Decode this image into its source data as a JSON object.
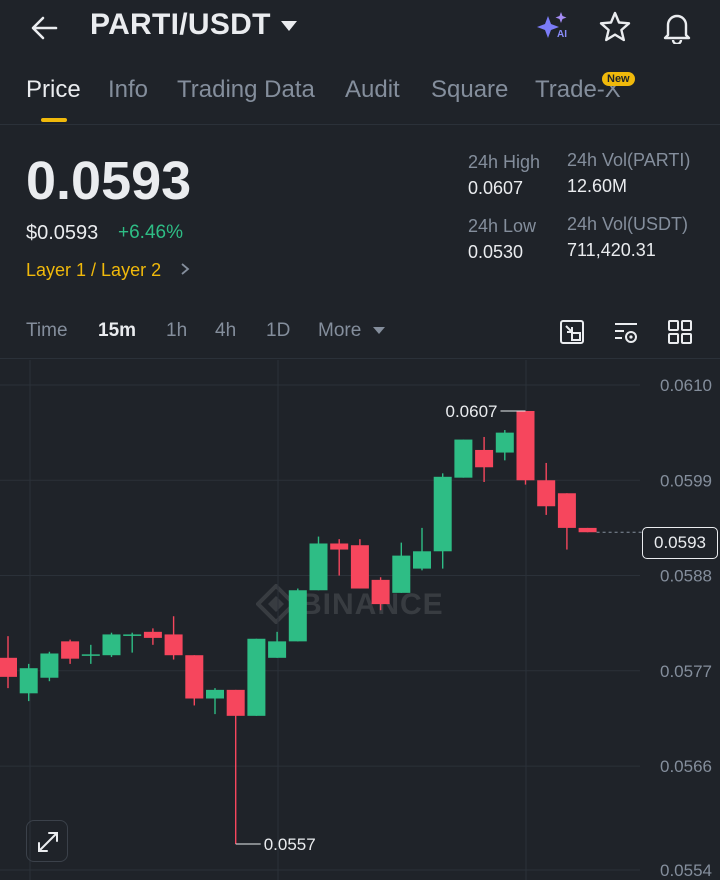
{
  "header": {
    "pair": "PARTI/USDT",
    "icons": [
      "back-arrow-icon",
      "caret-down-icon",
      "ai-sparkle-icon",
      "star-icon",
      "bell-icon"
    ]
  },
  "tabs": [
    {
      "label": "Price",
      "active": true
    },
    {
      "label": "Info"
    },
    {
      "label": "Trading Data"
    },
    {
      "label": "Audit"
    },
    {
      "label": "Square"
    },
    {
      "label": "Trade-X",
      "badge": "New"
    }
  ],
  "price": {
    "last": "0.0593",
    "usd": "$0.0593",
    "change": "+6.46%",
    "category": "Layer 1 / Layer 2"
  },
  "stats": {
    "high_label": "24h High",
    "high_value": "0.0607",
    "low_label": "24h Low",
    "low_value": "0.0530",
    "vol_base_label": "24h Vol(PARTI)",
    "vol_base_value": "12.60M",
    "vol_quote_label": "24h Vol(USDT)",
    "vol_quote_value": "711,420.31"
  },
  "intervals": [
    "Time",
    "15m",
    "1h",
    "4h",
    "1D",
    "More"
  ],
  "active_interval": "15m",
  "toolbar_icons": [
    "indicator-settings-icon",
    "chart-settings-icon",
    "grid-layout-icon"
  ],
  "colors": {
    "up": "#2ebd85",
    "down": "#f6465d",
    "accent": "#f0b90b",
    "background": "#1f2329"
  },
  "chart_data": {
    "type": "candlestick",
    "y_ticks": [
      "0.0610",
      "0.0599",
      "0.0588",
      "0.0577",
      "0.0566",
      "0.0554"
    ],
    "ylim": [
      0.0554,
      0.061
    ],
    "current_price": "0.0593",
    "high_marker": "0.0607",
    "low_marker": "0.0557",
    "watermark": "BINANCE",
    "candles": [
      {
        "o": 0.05785,
        "h": 0.0581,
        "l": 0.0575,
        "c": 0.05763
      },
      {
        "o": 0.05744,
        "h": 0.05778,
        "l": 0.05735,
        "c": 0.05773
      },
      {
        "o": 0.05762,
        "h": 0.05792,
        "l": 0.05758,
        "c": 0.0579
      },
      {
        "o": 0.05804,
        "h": 0.05806,
        "l": 0.05778,
        "c": 0.05784
      },
      {
        "o": 0.05788,
        "h": 0.058,
        "l": 0.05778,
        "c": 0.05789
      },
      {
        "o": 0.05788,
        "h": 0.05814,
        "l": 0.05786,
        "c": 0.05812
      },
      {
        "o": 0.05812,
        "h": 0.05814,
        "l": 0.05791,
        "c": 0.05812
      },
      {
        "o": 0.05815,
        "h": 0.05819,
        "l": 0.058,
        "c": 0.05808
      },
      {
        "o": 0.05812,
        "h": 0.05833,
        "l": 0.05783,
        "c": 0.05788
      },
      {
        "o": 0.05788,
        "h": 0.05788,
        "l": 0.0573,
        "c": 0.05738
      },
      {
        "o": 0.05738,
        "h": 0.0575,
        "l": 0.0572,
        "c": 0.05748
      },
      {
        "o": 0.05748,
        "h": 0.05748,
        "l": 0.0557,
        "c": 0.05718
      },
      {
        "o": 0.05718,
        "h": 0.05807,
        "l": 0.05718,
        "c": 0.05807
      },
      {
        "o": 0.05785,
        "h": 0.05815,
        "l": 0.05785,
        "c": 0.05804
      },
      {
        "o": 0.05804,
        "h": 0.05865,
        "l": 0.05804,
        "c": 0.05863
      },
      {
        "o": 0.05863,
        "h": 0.05925,
        "l": 0.05863,
        "c": 0.05917
      },
      {
        "o": 0.05917,
        "h": 0.05922,
        "l": 0.0588,
        "c": 0.0591
      },
      {
        "o": 0.05915,
        "h": 0.05922,
        "l": 0.05865,
        "c": 0.05865
      },
      {
        "o": 0.05875,
        "h": 0.05878,
        "l": 0.0584,
        "c": 0.05847
      },
      {
        "o": 0.0586,
        "h": 0.05918,
        "l": 0.0586,
        "c": 0.05903
      },
      {
        "o": 0.05888,
        "h": 0.05935,
        "l": 0.05886,
        "c": 0.05908
      },
      {
        "o": 0.05908,
        "h": 0.05998,
        "l": 0.05888,
        "c": 0.05994
      },
      {
        "o": 0.05993,
        "h": 0.06037,
        "l": 0.05993,
        "c": 0.06037
      },
      {
        "o": 0.06025,
        "h": 0.0604,
        "l": 0.05988,
        "c": 0.06005
      },
      {
        "o": 0.06022,
        "h": 0.06048,
        "l": 0.06013,
        "c": 0.06045
      },
      {
        "o": 0.0607,
        "h": 0.0607,
        "l": 0.05985,
        "c": 0.0599
      },
      {
        "o": 0.0599,
        "h": 0.0601,
        "l": 0.0595,
        "c": 0.0596
      },
      {
        "o": 0.05975,
        "h": 0.05975,
        "l": 0.0591,
        "c": 0.05935
      },
      {
        "o": 0.05935,
        "h": 0.05935,
        "l": 0.0593,
        "c": 0.0593
      }
    ]
  }
}
